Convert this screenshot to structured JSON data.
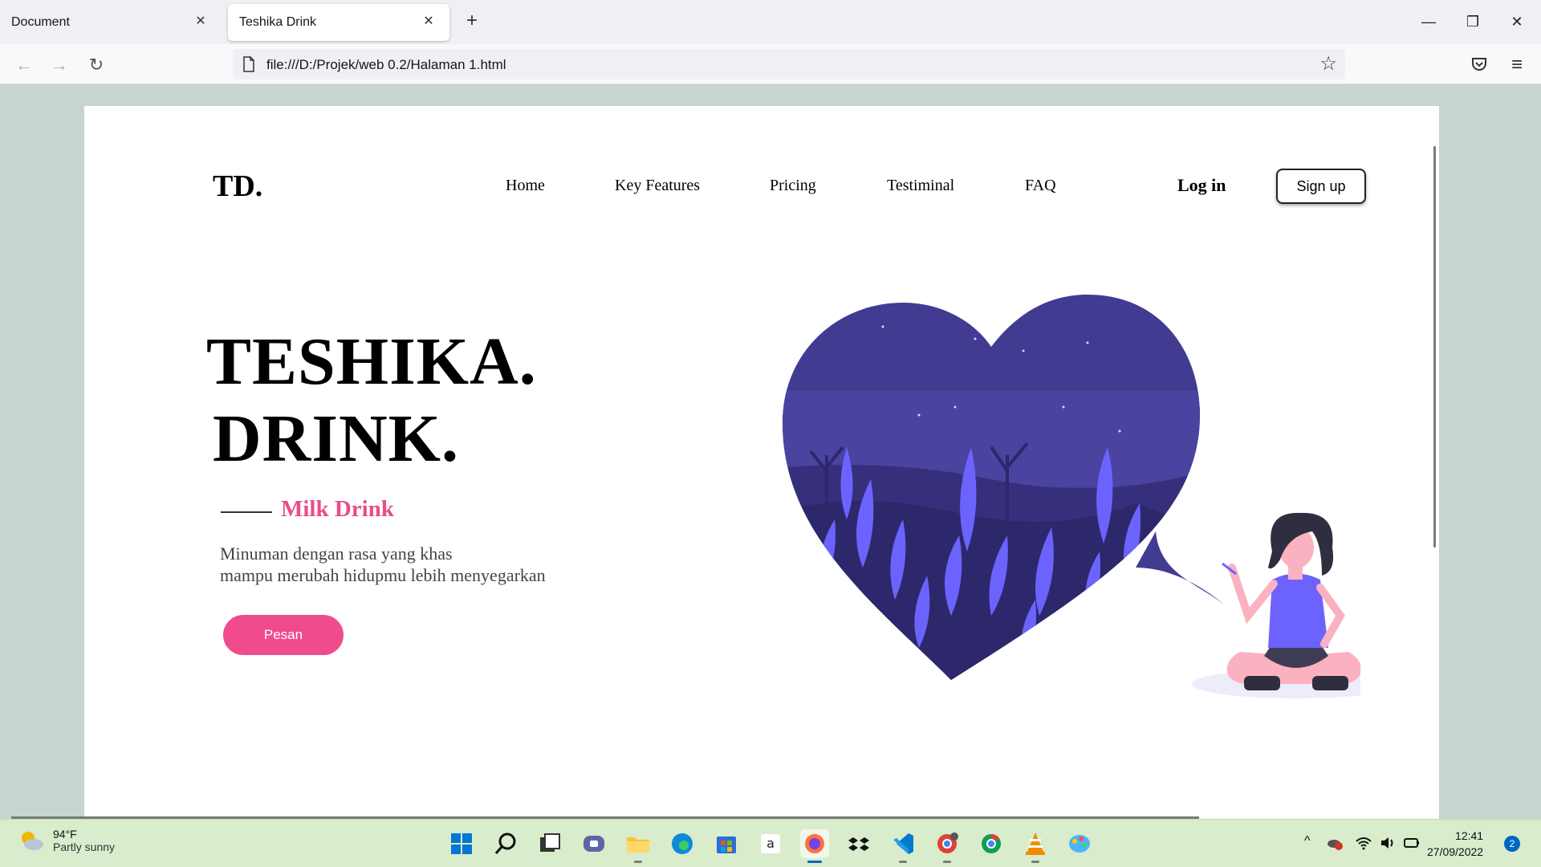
{
  "browser": {
    "tabs": [
      {
        "label": "Document",
        "active": false
      },
      {
        "label": "Teshika Drink",
        "active": true
      }
    ],
    "url": "file:///D:/Projek/web 0.2/Halaman 1.html"
  },
  "site": {
    "logo": "TD.",
    "nav": [
      "Home",
      "Key Features",
      "Pricing",
      "Testiminal",
      "FAQ"
    ],
    "login": "Log in",
    "signup": "Sign up",
    "hero": {
      "title_line1": "TESHIKA.",
      "title_line2": "DRINK.",
      "subtitle": "Milk Drink",
      "desc_line1": "Minuman dengan rasa yang khas",
      "desc_line2": "mampu merubah hidupmu lebih menyegarkan",
      "cta": "Pesan"
    },
    "colors": {
      "accent": "#ef4b8d",
      "heart": "#3f3d8f",
      "leaf": "#6c63ff"
    }
  },
  "taskbar": {
    "weather_temp": "94°F",
    "weather_desc": "Partly sunny",
    "time": "12:41",
    "date": "27/09/2022",
    "notifications": "2"
  }
}
